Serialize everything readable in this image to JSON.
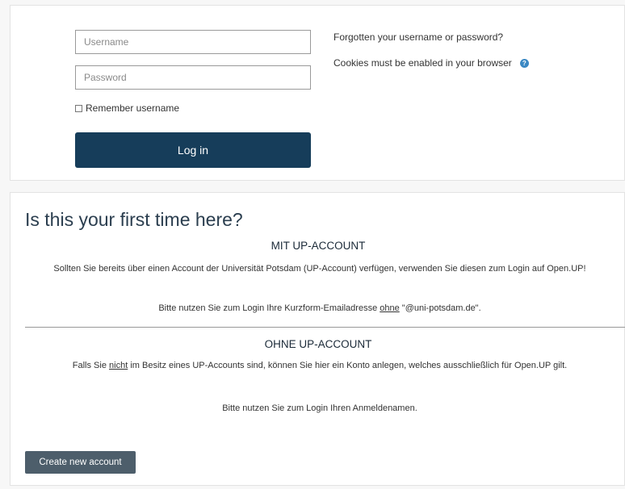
{
  "login": {
    "username_placeholder": "Username",
    "password_placeholder": "Password",
    "remember_label": "Remember username",
    "login_button": "Log in",
    "forgot_link": "Forgotten your username or password?",
    "cookies_note": "Cookies must be enabled in your browser",
    "help_icon": "question-circle-icon",
    "help_symbol": "?"
  },
  "signup": {
    "title": "Is this your first time here?",
    "mit": {
      "heading": "MIT UP-ACCOUNT",
      "text": "Sollten Sie bereits über einen Account der Universität Potsdam (UP-Account) verfügen, verwenden Sie diesen zum Login auf Open.UP!",
      "hint_before": "Bitte nutzen Sie zum Login Ihre Kurzform-Emailadresse ",
      "hint_emph": "ohne",
      "hint_after": " \"@uni-potsdam.de\"."
    },
    "ohne": {
      "heading": "OHNE UP-ACCOUNT",
      "text_before": "Falls Sie ",
      "text_emph": "nicht",
      "text_after": " im Besitz eines UP-Accounts sind, können Sie hier ein Konto anlegen, welches ausschließlich für Open.UP gilt.",
      "hint": "Bitte nutzen Sie zum Login Ihren Anmeldenamen."
    },
    "create_button": "Create new account"
  },
  "colors": {
    "login_button_bg": "#163d5a",
    "create_button_bg": "#4d5e6b",
    "help_icon": "#3b88c3",
    "title": "#2b3e4f"
  }
}
